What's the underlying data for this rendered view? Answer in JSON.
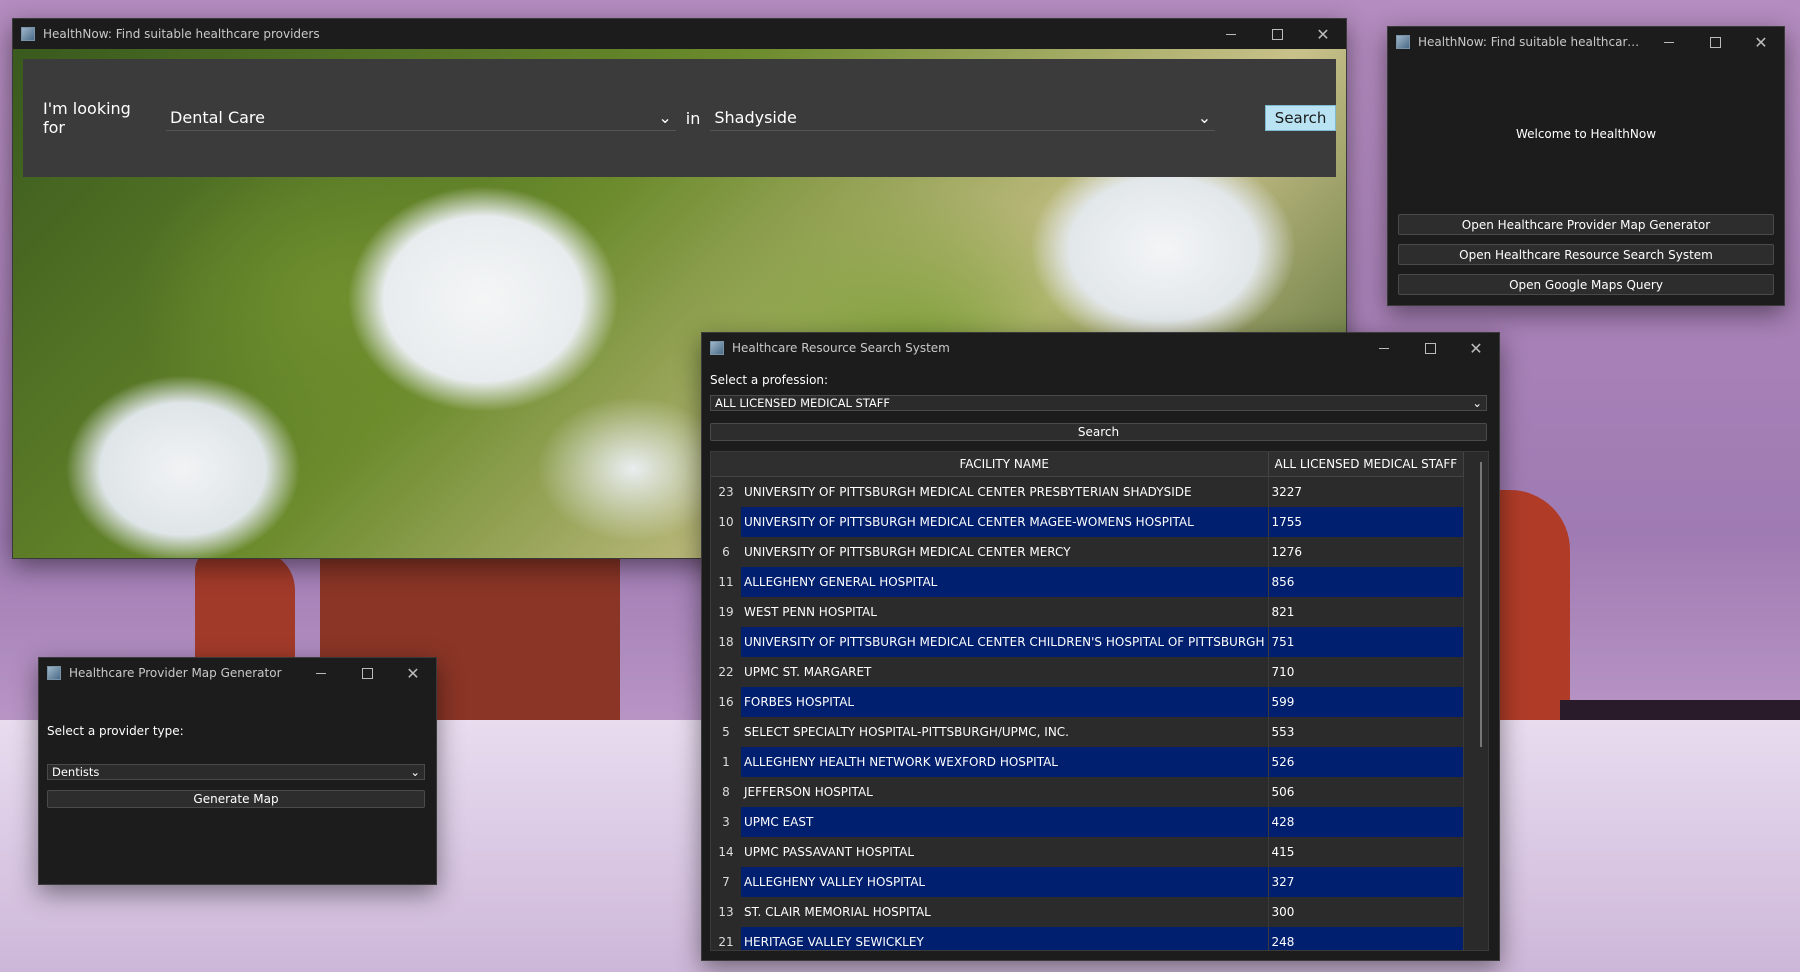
{
  "main_window": {
    "title": "HealthNow: Find suitable healthcare providers",
    "looking_for_label": "I'm looking for",
    "service_value": "Dental Care",
    "in_label": "in",
    "location_value": "Shadyside",
    "search_label": "Search"
  },
  "welcome_window": {
    "title": "HealthNow: Find suitable healthcare provi...",
    "welcome_text": "Welcome to HealthNow",
    "buttons": [
      "Open Healthcare Provider Map Generator",
      "Open Healthcare Resource Search System",
      "Open Google Maps Query"
    ]
  },
  "resource_window": {
    "title": "Healthcare Resource Search System",
    "profession_label": "Select a profession:",
    "profession_value": "ALL LICENSED MEDICAL STAFF",
    "search_label": "Search",
    "columns": [
      "FACILITY NAME",
      "ALL LICENSED MEDICAL STAFF"
    ],
    "rows": [
      {
        "row": "23",
        "name": "UNIVERSITY OF PITTSBURGH MEDICAL CENTER PRESBYTERIAN SHADYSIDE",
        "count": "3227"
      },
      {
        "row": "10",
        "name": "UNIVERSITY OF PITTSBURGH MEDICAL CENTER MAGEE-WOMENS HOSPITAL",
        "count": "1755"
      },
      {
        "row": "6",
        "name": "UNIVERSITY OF PITTSBURGH MEDICAL CENTER MERCY",
        "count": "1276"
      },
      {
        "row": "11",
        "name": "ALLEGHENY GENERAL HOSPITAL",
        "count": "856"
      },
      {
        "row": "19",
        "name": "WEST PENN HOSPITAL",
        "count": "821"
      },
      {
        "row": "18",
        "name": "UNIVERSITY OF PITTSBURGH MEDICAL CENTER CHILDREN'S HOSPITAL OF PITTSBURGH",
        "count": "751"
      },
      {
        "row": "22",
        "name": "UPMC ST. MARGARET",
        "count": "710"
      },
      {
        "row": "16",
        "name": "FORBES HOSPITAL",
        "count": "599"
      },
      {
        "row": "5",
        "name": "SELECT SPECIALTY HOSPITAL-PITTSBURGH/UPMC, INC.",
        "count": "553"
      },
      {
        "row": "1",
        "name": "ALLEGHENY HEALTH NETWORK WEXFORD HOSPITAL",
        "count": "526"
      },
      {
        "row": "8",
        "name": "JEFFERSON HOSPITAL",
        "count": "506"
      },
      {
        "row": "3",
        "name": "UPMC EAST",
        "count": "428"
      },
      {
        "row": "14",
        "name": "UPMC PASSAVANT HOSPITAL",
        "count": "415"
      },
      {
        "row": "7",
        "name": "ALLEGHENY VALLEY HOSPITAL",
        "count": "327"
      },
      {
        "row": "13",
        "name": "ST. CLAIR MEMORIAL HOSPITAL",
        "count": "300"
      },
      {
        "row": "21",
        "name": "HERITAGE VALLEY SEWICKLEY",
        "count": "248"
      }
    ]
  },
  "map_window": {
    "title": "Healthcare Provider Map Generator",
    "provider_label": "Select a provider type:",
    "provider_value": "Dentists",
    "generate_label": "Generate Map"
  },
  "colors": {
    "row_highlight": "#001f6e",
    "search_button": "#b9e3f3"
  }
}
